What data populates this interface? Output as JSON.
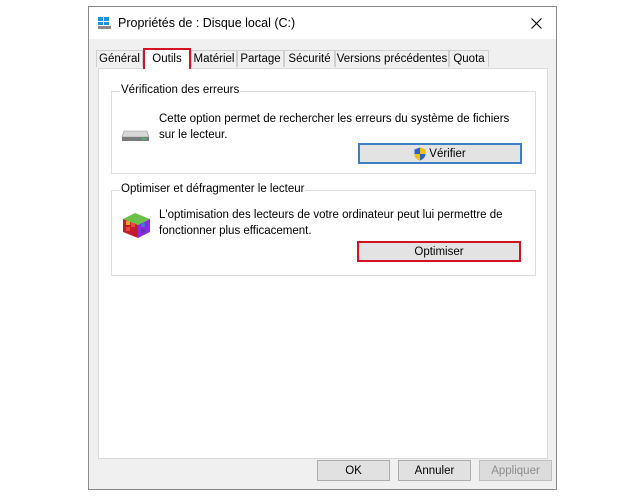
{
  "window": {
    "title": "Propriétés de : Disque local (C:)"
  },
  "tabs": [
    {
      "label": "Général"
    },
    {
      "label": "Outils"
    },
    {
      "label": "Matériel"
    },
    {
      "label": "Partage"
    },
    {
      "label": "Sécurité"
    },
    {
      "label": "Versions précédentes"
    },
    {
      "label": "Quota"
    }
  ],
  "active_tab": "Outils",
  "error_check": {
    "title": "Vérification des erreurs",
    "text": "Cette option permet de rechercher les erreurs du système de fichiers sur le lecteur.",
    "button": "Vérifier",
    "icon": "drive-icon"
  },
  "optimize": {
    "title": "Optimiser et défragmenter le lecteur",
    "text": "L'optimisation des lecteurs de votre ordinateur peut lui permettre de fonctionner plus efficacement.",
    "button": "Optimiser",
    "icon": "defrag-icon"
  },
  "footer": {
    "ok": "OK",
    "cancel": "Annuler",
    "apply": "Appliquer"
  },
  "colors": {
    "highlight": "#d3131f",
    "focus": "#3c7fc2",
    "dialog_bg": "#f0f0f0"
  }
}
